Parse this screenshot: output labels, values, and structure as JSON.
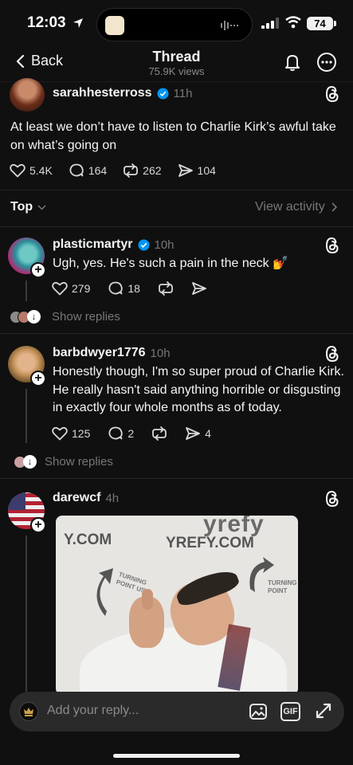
{
  "status": {
    "time": "12:03",
    "battery": "74"
  },
  "header": {
    "back_label": "Back",
    "title": "Thread",
    "views": "75.9K views"
  },
  "main_post": {
    "username": "sarahhesterross",
    "time": "11h",
    "text": "At least we don’t have to listen to Charlie Kirk’s awful take on what’s going on",
    "likes": "5.4K",
    "comments": "164",
    "reposts": "262",
    "shares": "104"
  },
  "sort": {
    "label": "Top",
    "view_activity": "View activity"
  },
  "replies": [
    {
      "username": "plasticmartyr",
      "time": "10h",
      "text": "Ugh, yes. He's such a pain in the neck 💅",
      "likes": "279",
      "comments": "18",
      "show_replies": "Show replies"
    },
    {
      "username": "barbdwyer1776",
      "time": "10h",
      "text": "Honestly though, I'm so super proud of Charlie Kirk. He really hasn't said anything horrible or disgusting in exactly four whole months as of today.",
      "likes": "125",
      "comments": "2",
      "shares": "4",
      "show_replies": "Show replies"
    },
    {
      "username": "darewcf",
      "time": "4h",
      "media": {
        "banner_left": "Y.COM",
        "banner_right": "YREFY.COM",
        "banner_top": "yrefy",
        "logo_left": "TURNING POINT USA",
        "logo_right": "TURNING POINT"
      }
    }
  ],
  "composer": {
    "placeholder": "Add your reply...",
    "gif_label": "GIF"
  },
  "colors": {
    "background": "#101010",
    "verified": "#0095f6",
    "muted": "#777777"
  }
}
